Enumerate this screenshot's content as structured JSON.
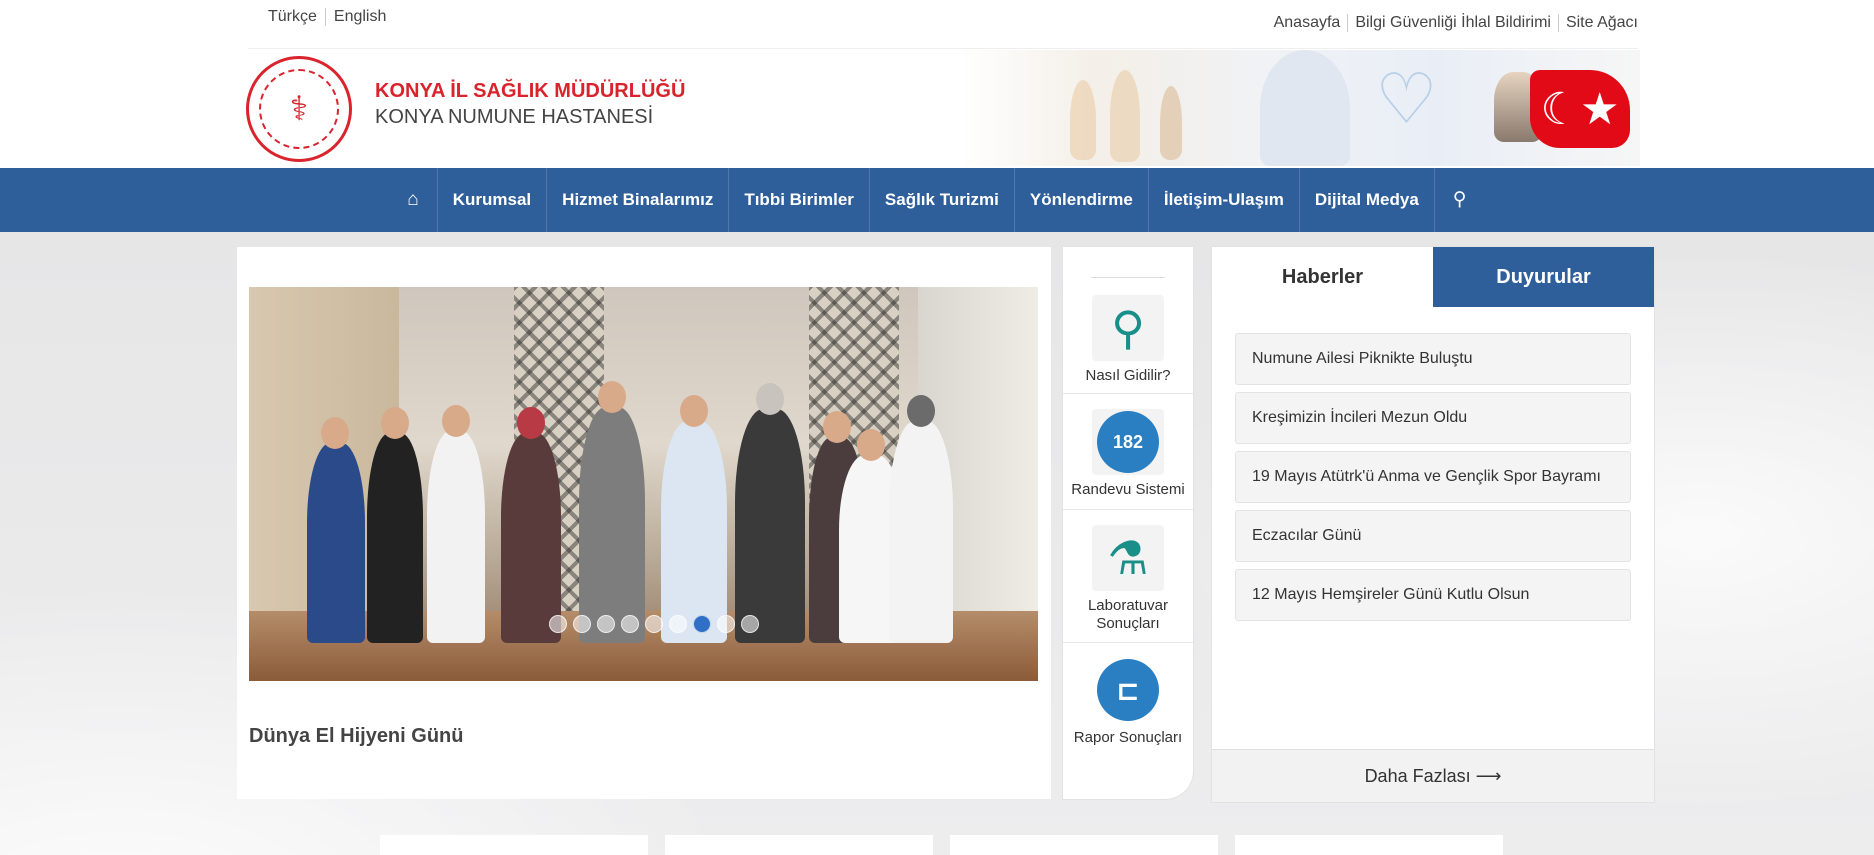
{
  "lang": {
    "tr": "Türkçe",
    "en": "English"
  },
  "toplinks": [
    "Anasayfa",
    "Bilgi Güvenliği İhlal Bildirimi",
    "Site Ağacı"
  ],
  "org": {
    "line1": "KONYA İL SAĞLIK MÜDÜRLÜĞÜ",
    "line2": "KONYA NUMUNE HASTANESİ"
  },
  "nav": {
    "home_icon": "home-icon",
    "items": [
      "Kurumsal",
      "Hizmet Binalarımız",
      "Tıbbi Birimler",
      "Sağlık Turizmi",
      "Yönlendirme",
      "İletişim-Ulaşım",
      "Dijital Medya"
    ],
    "search_icon": "search-icon"
  },
  "slider": {
    "caption": "Dünya El Hijyeni Günü",
    "dots_total": 9,
    "active_dot": 7
  },
  "quick": {
    "items": [
      {
        "label": "Nasıl Gidilir?",
        "icon": "map-pin-icon"
      },
      {
        "label": "Randevu Sistemi",
        "icon": "phone-182-icon",
        "badge": "182"
      },
      {
        "label": "Laboratuvar Sonuçları",
        "icon": "microscope-icon"
      },
      {
        "label": "Rapor Sonuçları",
        "icon": "scanner-icon"
      }
    ]
  },
  "news": {
    "tabs": [
      "Haberler",
      "Duyurular"
    ],
    "items": [
      "Numune Ailesi Piknikte Buluştu",
      "Kreşimizin İncileri Mezun Oldu",
      "19 Mayıs Atütrk'ü Anma ve Gençlik Spor Bayramı",
      "Eczacılar Günü",
      "12 Mayıs Hemşireler Günü Kutlu Olsun"
    ],
    "more": "Daha Fazlası ⟶"
  },
  "colors": {
    "nav": "#2f5f9b",
    "brand_red": "#d9232d",
    "accent_blue": "#2a7fc2"
  }
}
